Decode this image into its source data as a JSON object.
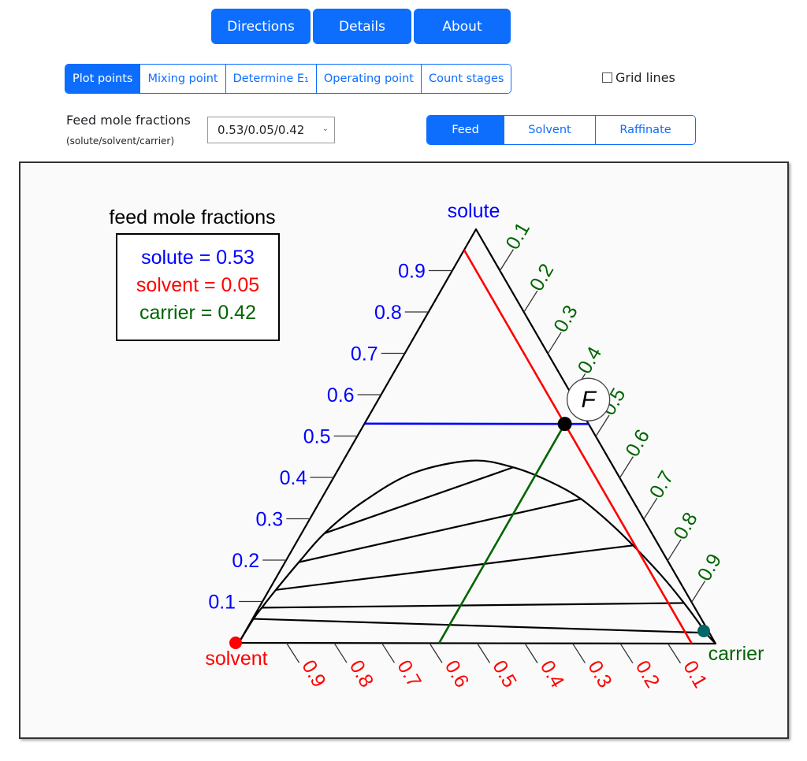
{
  "top_buttons": [
    "Directions",
    "Details",
    "About"
  ],
  "tabs": [
    {
      "label": "Plot points",
      "active": true
    },
    {
      "label": "Mixing point",
      "active": false
    },
    {
      "label": "Determine E₁",
      "active": false
    },
    {
      "label": "Operating point",
      "active": false
    },
    {
      "label": "Count stages",
      "active": false
    }
  ],
  "grid_lines": {
    "label": "Grid lines",
    "checked": false
  },
  "feed_selector": {
    "label": "Feed mole fractions",
    "sublabel": "(solute/solvent/carrier)",
    "value": "0.53/0.05/0.42"
  },
  "stream_buttons": [
    {
      "label": "Feed",
      "active": true
    },
    {
      "label": "Solvent",
      "active": false
    },
    {
      "label": "Raffinate",
      "active": false
    }
  ],
  "colors": {
    "primary": "#0d6efd",
    "solute": "#0000ff",
    "solvent": "#ff0000",
    "carrier": "#006400",
    "carrier_point": "#006666"
  },
  "chart_data": {
    "type": "ternary",
    "vertices": {
      "top": "solute",
      "left": "solvent",
      "right": "carrier"
    },
    "legend": {
      "title": "feed mole fractions",
      "entries": [
        {
          "text": "solute = 0.53",
          "color": "#0000ff"
        },
        {
          "text": "solvent = 0.05",
          "color": "#ff0000"
        },
        {
          "text": "carrier = 0.42",
          "color": "#006400"
        }
      ]
    },
    "ticks": [
      "0.1",
      "0.2",
      "0.3",
      "0.4",
      "0.5",
      "0.6",
      "0.7",
      "0.8",
      "0.9"
    ],
    "feed": {
      "label": "F",
      "solute": 0.53,
      "solvent": 0.05,
      "carrier": 0.42
    },
    "carrier_point": {
      "solute": 0.0,
      "solvent": 0.0,
      "carrier": 1.0
    },
    "solvent_point": {
      "solute": 0.0,
      "solvent": 1.0,
      "carrier": 0.0
    },
    "binodal": [
      {
        "solute": 0.0,
        "solvent": 1.0,
        "carrier": 0.0
      },
      {
        "solute": 0.058,
        "solvent": 0.94,
        "carrier": 0.002
      },
      {
        "solute": 0.085,
        "solvent": 0.909,
        "carrier": 0.006
      },
      {
        "solute": 0.128,
        "solvent": 0.858,
        "carrier": 0.014
      },
      {
        "solute": 0.195,
        "solvent": 0.776,
        "carrier": 0.029
      },
      {
        "solute": 0.265,
        "solvent": 0.687,
        "carrier": 0.048
      },
      {
        "solute": 0.34,
        "solvent": 0.57,
        "carrier": 0.09
      },
      {
        "solute": 0.41,
        "solvent": 0.43,
        "carrier": 0.16
      },
      {
        "solute": 0.441,
        "solvent": 0.291,
        "carrier": 0.268
      },
      {
        "solute": 0.425,
        "solvent": 0.211,
        "carrier": 0.364
      },
      {
        "solute": 0.39,
        "solvent": 0.15,
        "carrier": 0.46
      },
      {
        "solute": 0.349,
        "solvent": 0.107,
        "carrier": 0.544
      },
      {
        "solute": 0.29,
        "solvent": 0.075,
        "carrier": 0.635
      },
      {
        "solute": 0.237,
        "solvent": 0.054,
        "carrier": 0.709
      },
      {
        "solute": 0.16,
        "solvent": 0.03,
        "carrier": 0.81
      },
      {
        "solute": 0.098,
        "solvent": 0.017,
        "carrier": 0.885
      },
      {
        "solute": 0.05,
        "solvent": 0.01,
        "carrier": 0.94
      },
      {
        "solute": 0.026,
        "solvent": 0.008,
        "carrier": 0.966
      },
      {
        "solute": 0.0,
        "solvent": 0.0,
        "carrier": 1.0
      }
    ],
    "tie_lines": [
      [
        {
          "solute": 0.265,
          "solvent": 0.687,
          "carrier": 0.048
        },
        {
          "solute": 0.425,
          "solvent": 0.211,
          "carrier": 0.364
        }
      ],
      [
        {
          "solute": 0.195,
          "solvent": 0.776,
          "carrier": 0.029
        },
        {
          "solute": 0.349,
          "solvent": 0.107,
          "carrier": 0.544
        }
      ],
      [
        {
          "solute": 0.128,
          "solvent": 0.858,
          "carrier": 0.014
        },
        {
          "solute": 0.237,
          "solvent": 0.054,
          "carrier": 0.709
        }
      ],
      [
        {
          "solute": 0.085,
          "solvent": 0.909,
          "carrier": 0.006
        },
        {
          "solute": 0.098,
          "solvent": 0.017,
          "carrier": 0.885
        }
      ],
      [
        {
          "solute": 0.058,
          "solvent": 0.94,
          "carrier": 0.002
        },
        {
          "solute": 0.026,
          "solvent": 0.008,
          "carrier": 0.966
        }
      ]
    ],
    "guide_lines": [
      {
        "name": "solute-line",
        "color": "#0000ff",
        "from": {
          "solute": 0.53,
          "solvent": 0.47,
          "carrier": 0.0
        },
        "to": {
          "solute": 0.53,
          "solvent": 0.0,
          "carrier": 0.47
        }
      },
      {
        "name": "solvent-line",
        "color": "#ff0000",
        "from": {
          "solute": 0.95,
          "solvent": 0.05,
          "carrier": 0.0
        },
        "to": {
          "solute": 0.0,
          "solvent": 0.05,
          "carrier": 0.95
        }
      },
      {
        "name": "carrier-line",
        "color": "#006400",
        "from": {
          "solute": 0.0,
          "solvent": 0.58,
          "carrier": 0.42
        },
        "to": {
          "solute": 0.545,
          "solvent": 0.035,
          "carrier": 0.42
        }
      }
    ]
  }
}
